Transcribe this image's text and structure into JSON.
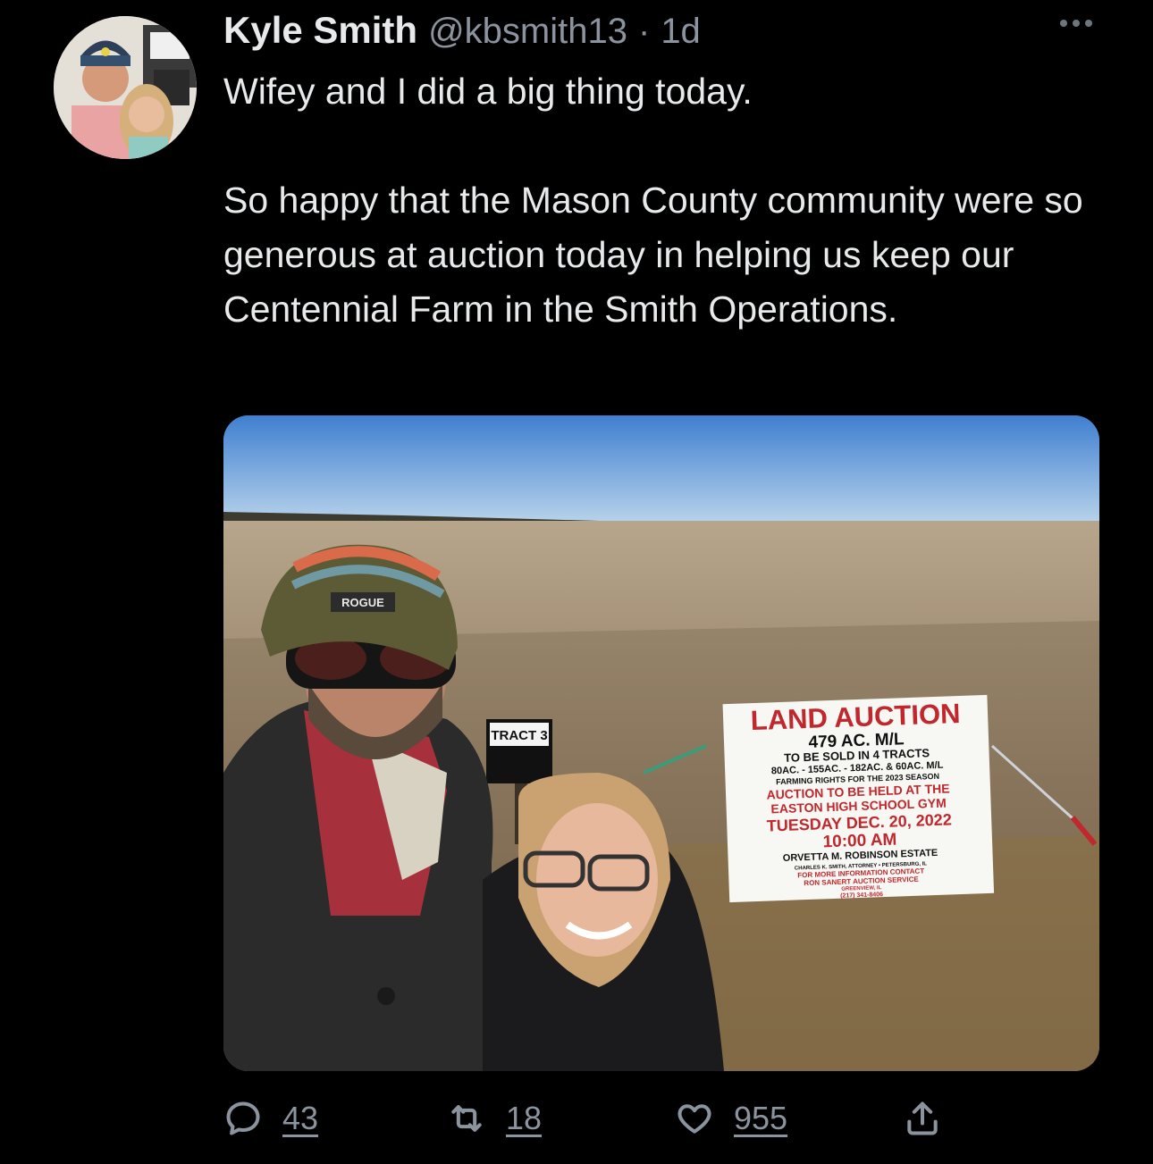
{
  "tweet": {
    "author_name": "Kyle Smith",
    "handle": "@kbsmith13",
    "separator": "·",
    "age": "1d",
    "paragraphs": [
      "Wifey and I did a big thing today.",
      "So happy that the Mason County community were so generous at auction today in helping us keep our Centennial Farm in the Smith Operations."
    ]
  },
  "photo": {
    "sign": {
      "title": "LAND AUCTION",
      "lines": [
        "479 AC. M/L",
        "TO BE SOLD IN 4 TRACTS",
        "80AC. - 155AC. - 182AC. & 60AC. M/L",
        "FARMING RIGHTS FOR THE 2023 SEASON",
        "AUCTION TO BE HELD AT THE",
        "EASTON HIGH SCHOOL GYM",
        "TUESDAY DEC. 20, 2022",
        "10:00 AM",
        "ORVETTA M. ROBINSON ESTATE",
        "CHARLES K. SMITH, ATTORNEY • PETERSBURG, IL",
        "FOR MORE INFORMATION CONTACT",
        "RON SANERT AUCTION SERVICE",
        "GREENVIEW, IL",
        "(217) 341-8406"
      ]
    },
    "tract_sign": "TRACT 3",
    "hat_label": "ROGUE"
  },
  "actions": {
    "replies": "43",
    "retweets": "18",
    "likes": "955"
  },
  "colors": {
    "background": "#000000",
    "text": "#e7e9ea",
    "muted": "#8b949e",
    "sign_red": "#c0282d"
  }
}
